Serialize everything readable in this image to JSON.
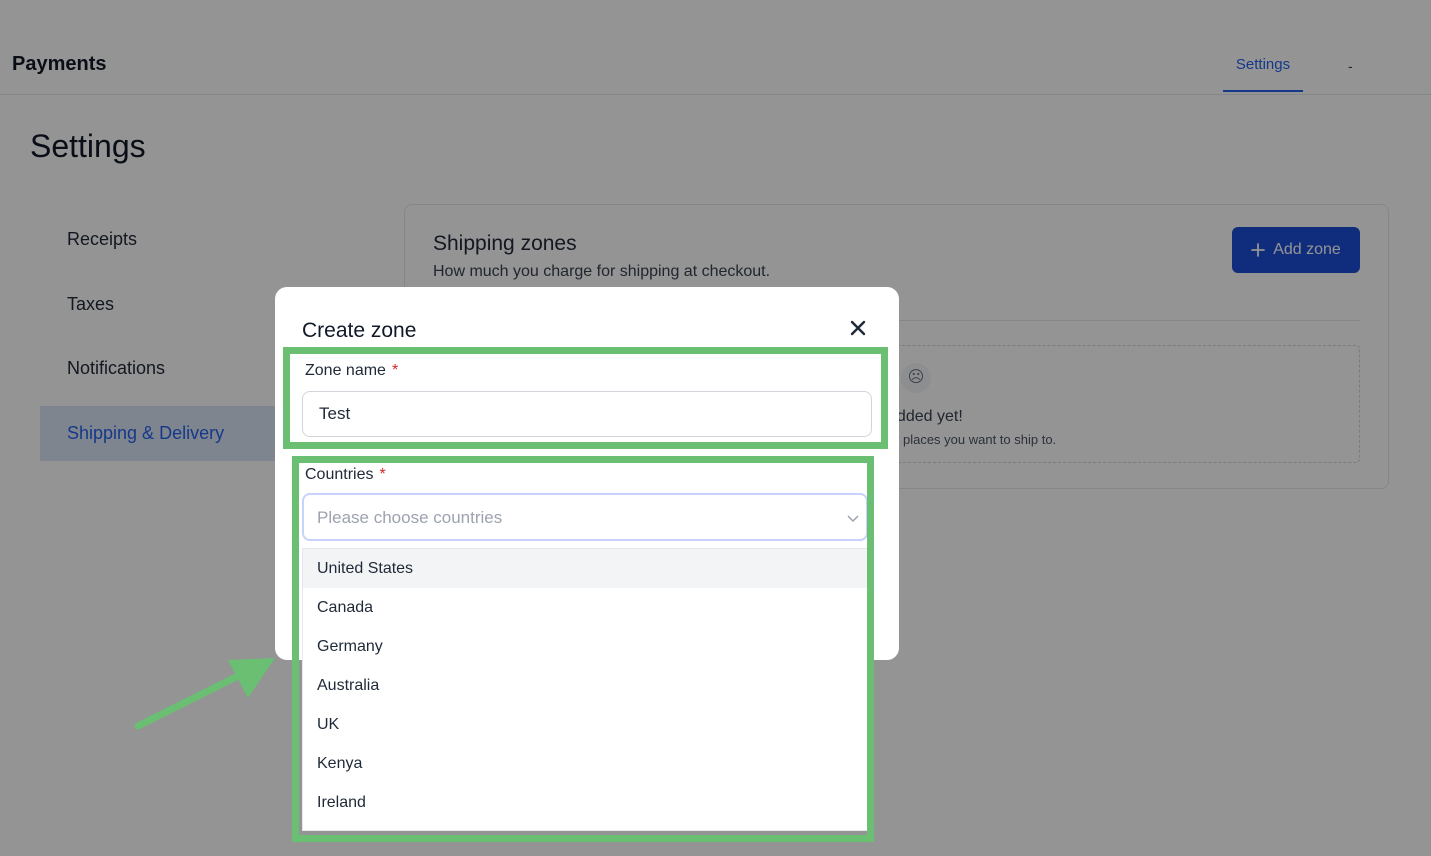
{
  "header": {
    "app_title": "Payments",
    "tab_settings": "Settings",
    "tab_more": "-"
  },
  "page": {
    "heading": "Settings"
  },
  "sidebar": {
    "items": [
      {
        "label": "Receipts",
        "active": false
      },
      {
        "label": "Taxes",
        "active": false
      },
      {
        "label": "Notifications",
        "active": false
      },
      {
        "label": "Shipping & Delivery",
        "active": true
      }
    ]
  },
  "shipping_zones": {
    "title": "Shipping zones",
    "subtitle": "How much you charge for shipping at checkout.",
    "add_zone_label": "Add zone",
    "empty_title_visible": "added yet!",
    "empty_desc_visible": "es for places you want to ship to."
  },
  "modal": {
    "title": "Create zone",
    "zone_name_label": "Zone name",
    "zone_name_value": "Test",
    "countries_label": "Countries",
    "required_mark": "*",
    "countries_placeholder": "Please choose countries",
    "options": [
      "United States",
      "Canada",
      "Germany",
      "Australia",
      "UK",
      "Kenya",
      "Ireland"
    ],
    "hovered_option": "United States"
  },
  "colors": {
    "accent": "#2563eb",
    "button": "#1d4ed8",
    "highlight": "#6abf73",
    "required": "#dc2626"
  }
}
